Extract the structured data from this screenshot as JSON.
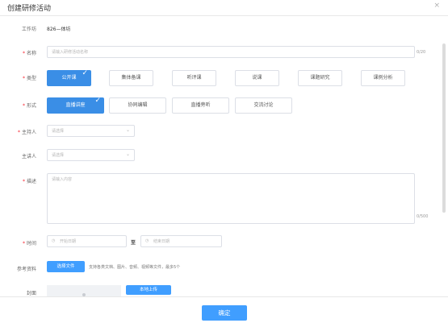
{
  "dialog": {
    "title": "创建研修活动",
    "close_icon": "×"
  },
  "form": {
    "workspace": {
      "label": "工作坊",
      "value": "826—体坊"
    },
    "name": {
      "label": "名称",
      "placeholder": "请输入研修活动名称",
      "counter": "0/20"
    },
    "type": {
      "label": "类型",
      "options": [
        "公开课",
        "集体备课",
        "听评课",
        "说课",
        "课题研究",
        "课例分析"
      ],
      "selected": "公开课"
    },
    "format": {
      "label": "形式",
      "options": [
        "直播讲座",
        "协同编辑",
        "直播旁听",
        "交流讨论"
      ],
      "selected": "直播讲座"
    },
    "host": {
      "label": "主持人",
      "placeholder": "请选择"
    },
    "speaker": {
      "label": "主讲人",
      "placeholder": "请选择"
    },
    "description": {
      "label": "描述",
      "placeholder": "请输入内容",
      "counter": "0/500"
    },
    "time": {
      "label": "时间",
      "start_placeholder": "开始日期",
      "separator": "至",
      "end_placeholder": "结束日期"
    },
    "materials": {
      "label": "参考资料",
      "button": "选择文件",
      "hint": "支持各类文档、图片、音频、视频等文件，最多5个"
    },
    "cover": {
      "label": "封面",
      "button": "本地上传"
    }
  },
  "footer": {
    "confirm": "确定"
  },
  "colors": {
    "primary": "#409eff",
    "selected_chip": "#3a8ee6",
    "required": "#f5222d",
    "border": "#dcdfe6"
  },
  "icons": {
    "check": "✓",
    "chevron": "⌄",
    "calendar": "◷"
  }
}
